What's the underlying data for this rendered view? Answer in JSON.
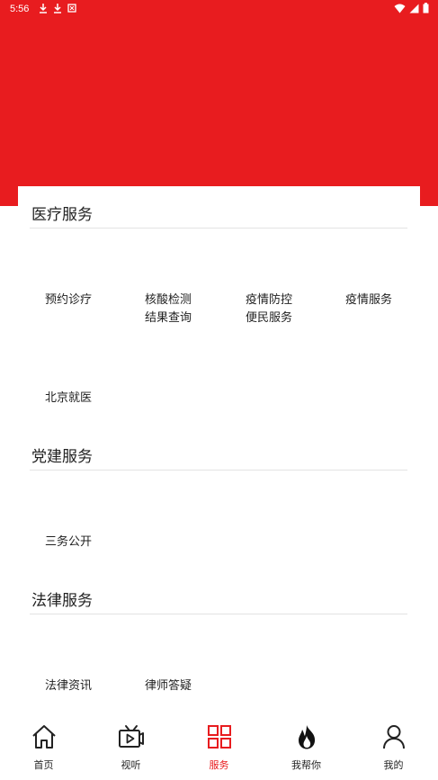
{
  "colors": {
    "brand_red": "#e81c1f",
    "text": "#222222",
    "divider": "#e3e3e3"
  },
  "status_bar": {
    "time": "5:56",
    "left_icons": [
      "download-icon",
      "download-icon",
      "app-notification-icon"
    ],
    "right_icons": [
      "wifi-icon",
      "signal-icon",
      "battery-icon"
    ]
  },
  "sections": [
    {
      "title": "医疗服务",
      "items": [
        {
          "lines": [
            "预约诊疗"
          ]
        },
        {
          "lines": [
            "核酸检测",
            "结果查询"
          ]
        },
        {
          "lines": [
            "疫情防控",
            "便民服务"
          ]
        },
        {
          "lines": [
            "疫情服务"
          ]
        },
        {
          "lines": [
            "北京就医"
          ]
        }
      ]
    },
    {
      "title": "党建服务",
      "items": [
        {
          "lines": [
            "三务公开"
          ]
        }
      ]
    },
    {
      "title": "法律服务",
      "items": [
        {
          "lines": [
            "法律资讯"
          ]
        },
        {
          "lines": [
            "律师答疑"
          ]
        }
      ]
    }
  ],
  "bottom_nav": {
    "items": [
      {
        "label": "首页",
        "icon": "home-icon",
        "active": false
      },
      {
        "label": "视听",
        "icon": "video-icon",
        "active": false
      },
      {
        "label": "服务",
        "icon": "grid-icon",
        "active": true
      },
      {
        "label": "我帮你",
        "icon": "flame-icon",
        "active": false
      },
      {
        "label": "我的",
        "icon": "user-icon",
        "active": false
      }
    ]
  }
}
